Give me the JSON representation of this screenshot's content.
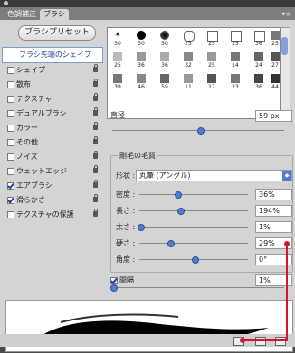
{
  "tabs": [
    "色調補正",
    "ブラシ"
  ],
  "panel_menu_icon": "panel-menu-icon",
  "preset_button": "ブラシプリセット",
  "left_list": [
    {
      "label": "ブラシ先端のシェイプ",
      "selected": true,
      "check": false,
      "lock": false
    },
    {
      "label": "シェイプ",
      "selected": false,
      "check": false,
      "lock": true
    },
    {
      "label": "散布",
      "selected": false,
      "check": false,
      "lock": true
    },
    {
      "label": "テクスチャ",
      "selected": false,
      "check": false,
      "lock": true
    },
    {
      "label": "デュアルブラシ",
      "selected": false,
      "check": false,
      "lock": true
    },
    {
      "label": "カラー",
      "selected": false,
      "check": false,
      "lock": true
    },
    {
      "label": "その他",
      "selected": false,
      "check": false,
      "lock": true
    },
    {
      "label": "ノイズ",
      "selected": false,
      "check": false,
      "lock": true
    },
    {
      "label": "ウェットエッジ",
      "selected": false,
      "check": false,
      "lock": true
    },
    {
      "label": "エアブラシ",
      "selected": false,
      "check": true,
      "lock": true
    },
    {
      "label": "滑らかさ",
      "selected": false,
      "check": true,
      "lock": true
    },
    {
      "label": "テクスチャの保護",
      "selected": false,
      "check": false,
      "lock": true
    }
  ],
  "brush_grid": [
    [
      "30",
      "30",
      "30",
      "25",
      "25",
      "25",
      "36"
    ],
    [
      "25",
      "36",
      "36",
      "32",
      "25",
      "14",
      "24"
    ],
    [
      "39",
      "46",
      "59",
      "11",
      "17",
      "23",
      "36"
    ]
  ],
  "extra_grid_numbers": [
    "25",
    "27",
    "44"
  ],
  "diameter": {
    "label": "直径",
    "value": "59 px"
  },
  "bristle_group": {
    "title": "剛毛の毛質"
  },
  "shape_select": {
    "label": "形状 :",
    "value": "丸筆 (アングル)"
  },
  "params": [
    {
      "label": "密度 :",
      "value": "36%"
    },
    {
      "label": "長さ :",
      "value": "194%"
    },
    {
      "label": "太さ :",
      "value": "1%"
    },
    {
      "label": "硬さ :",
      "value": "29%"
    },
    {
      "label": "角度 :",
      "value": "0°"
    }
  ],
  "spacing": {
    "label": "間隔",
    "checked": true,
    "value": "1%"
  },
  "accent_color": "#d8132e"
}
